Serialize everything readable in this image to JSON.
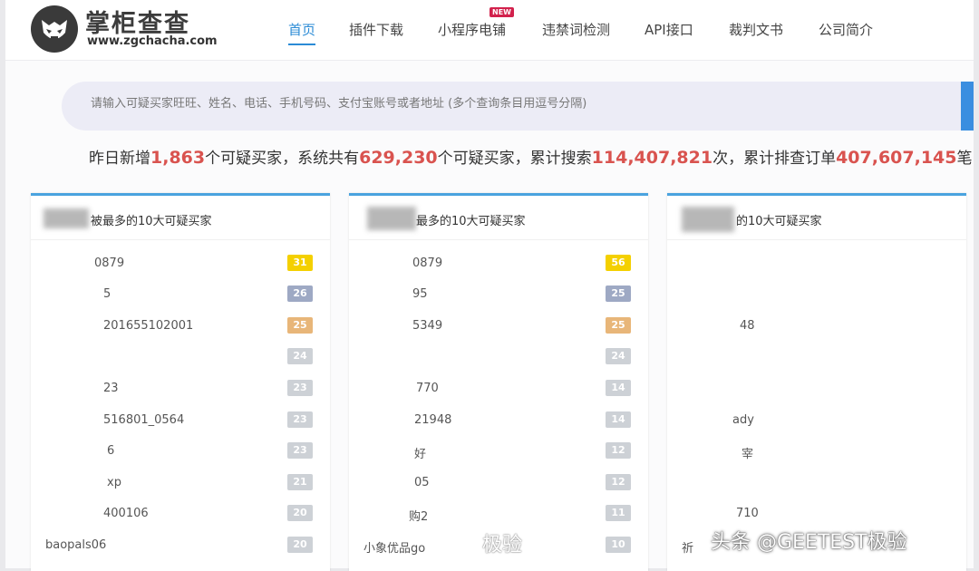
{
  "header": {
    "brand_name": "掌柜查查",
    "brand_url": "www.zgchacha.com",
    "nav": [
      {
        "label": "首页"
      },
      {
        "label": "插件下载"
      },
      {
        "label": "小程序电铺",
        "badge": "NEW"
      },
      {
        "label": "违禁词检测"
      },
      {
        "label": "API接口"
      },
      {
        "label": "裁判文书"
      },
      {
        "label": "公司简介"
      }
    ]
  },
  "search": {
    "placeholder": "请输入可疑买家旺旺、姓名、电话、手机号码、支付宝账号或者地址 (多个查询条目用逗号分隔)"
  },
  "stats": {
    "p1": "昨日新增",
    "n1": "1,863",
    "p2": "个可疑买家，系统共有",
    "n2": "629,230",
    "p3": "个可疑买家，累计搜索",
    "n3": "114,407,821",
    "p4": "次，累计排查订单",
    "n4": "407,607,145",
    "p5": "笔"
  },
  "panels": [
    {
      "title": "被最多的10大可疑买家",
      "rows": [
        {
          "name": "0879",
          "count": "31"
        },
        {
          "name": "5",
          "count": "26"
        },
        {
          "name": "201655102001",
          "count": "25"
        },
        {
          "name": "",
          "count": "24"
        },
        {
          "name": "23",
          "count": "23"
        },
        {
          "name": "516801_0564",
          "count": "23"
        },
        {
          "name": "6",
          "count": "23"
        },
        {
          "name": "xp",
          "count": "21"
        },
        {
          "name": "400106",
          "count": "20"
        },
        {
          "name": "baopals06",
          "count": "20"
        }
      ]
    },
    {
      "title": "最多的10大可疑买家",
      "rows": [
        {
          "name": "0879",
          "count": "56"
        },
        {
          "name": "95",
          "count": "25"
        },
        {
          "name": "5349",
          "count": "25"
        },
        {
          "name": "",
          "count": "24"
        },
        {
          "name": "770",
          "count": "14"
        },
        {
          "name": "21948",
          "count": "14"
        },
        {
          "name": "好",
          "count": "12"
        },
        {
          "name": "05",
          "count": "12"
        },
        {
          "name": "购2",
          "count": "11"
        },
        {
          "name": "小象优品go",
          "count": "10"
        }
      ]
    },
    {
      "title": "的10大可疑买家",
      "rows": [
        {
          "name": "",
          "count": ""
        },
        {
          "name": "",
          "count": ""
        },
        {
          "name": "48",
          "count": ""
        },
        {
          "name": "",
          "count": ""
        },
        {
          "name": "",
          "count": ""
        },
        {
          "name": "ady",
          "count": ""
        },
        {
          "name": "宰",
          "count": ""
        },
        {
          "name": "",
          "count": ""
        },
        {
          "name": "710",
          "count": ""
        },
        {
          "name": "祈",
          "count": ""
        }
      ]
    }
  ],
  "watermarks": {
    "weibo": "极验",
    "toutiao": "头条 @GEETEST极验"
  },
  "colors": {
    "accent_blue": "#2b8bd6",
    "number_red": "#d9534f",
    "badge_gold": "#f4d000",
    "badge_steel": "#9ea9c4",
    "badge_orange": "#e8b679",
    "badge_grey": "#cdd1d6"
  }
}
